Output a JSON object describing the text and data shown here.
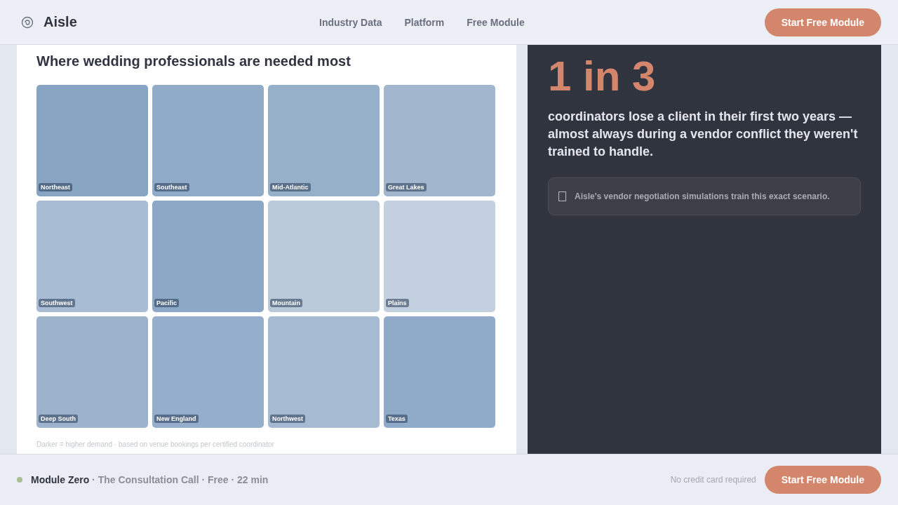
{
  "header": {
    "brand": "Aisle",
    "nav": [
      {
        "label": "Industry Data"
      },
      {
        "label": "Platform"
      },
      {
        "label": "Free Module"
      }
    ],
    "cta": "Start Free Module"
  },
  "demand": {
    "title": "Where wedding professionals are needed most",
    "regions": [
      {
        "name": "Northeast",
        "color": "#87a5c2"
      },
      {
        "name": "Southeast",
        "color": "#8fabc8"
      },
      {
        "name": "Mid-Atlantic",
        "color": "#97b0c9"
      },
      {
        "name": "Great Lakes",
        "color": "#a2b7ce"
      },
      {
        "name": "Southwest",
        "color": "#a8bcd3"
      },
      {
        "name": "Pacific",
        "color": "#8ba8c6"
      },
      {
        "name": "Mountain",
        "color": "#b9c9da"
      },
      {
        "name": "Plains",
        "color": "#c2d0df"
      },
      {
        "name": "Deep South",
        "color": "#9db3cc"
      },
      {
        "name": "New England",
        "color": "#95aecb"
      },
      {
        "name": "Northwest",
        "color": "#a6bbd2"
      },
      {
        "name": "Texas",
        "color": "#90abc9"
      }
    ],
    "note": "Darker = higher demand · based on venue bookings per certified coordinator"
  },
  "truth": {
    "stat": "1 in 3",
    "text": "coordinators lose a client in their first two years — almost always during a vendor conflict they weren't trained to handle.",
    "callout": "Aisle's vendor negotiation simulations train this exact scenario."
  },
  "footer": {
    "module": "Module Zero",
    "details": " · The Consultation Call · Free · 22 min",
    "note": "No credit card required",
    "cta": "Start Free Module"
  }
}
